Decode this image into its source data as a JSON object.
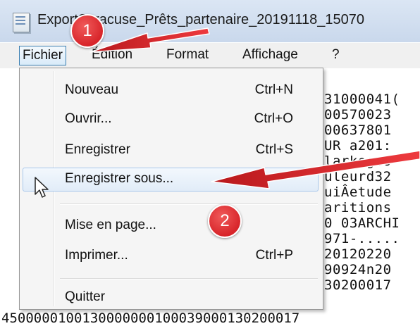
{
  "window": {
    "title": "ExportSyracuse_Prêts_partenaire_20191118_15070"
  },
  "menubar": {
    "items": [
      "Fichier",
      "Édition",
      "Format",
      "Affichage",
      "?"
    ]
  },
  "file_menu": {
    "items": [
      {
        "label": "Nouveau",
        "shortcut": "Ctrl+N"
      },
      {
        "label": "Ouvrir...",
        "shortcut": "Ctrl+O"
      },
      {
        "label": "Enregistrer",
        "shortcut": "Ctrl+S"
      },
      {
        "label": "Enregistrer sous...",
        "shortcut": ""
      },
      {
        "label": "Mise en page...",
        "shortcut": ""
      },
      {
        "label": "Imprimer...",
        "shortcut": "Ctrl+P"
      },
      {
        "label": "Quitter",
        "shortcut": ""
      }
    ]
  },
  "document": {
    "lines": [
      "31000041(",
      "00570023",
      "00637801",
      "UR  a201:",
      "larkegco",
      "uleurd32",
      "uiÂetude",
      "aritions",
      "0 03ARCHI",
      "971-.....",
      "20120220",
      "90924n20",
      "30200017"
    ],
    "bottom_line": "4500000100130000000100039000130200017"
  },
  "annotations": {
    "step1": "1",
    "step2": "2",
    "arrow_color": "#e0262b"
  }
}
